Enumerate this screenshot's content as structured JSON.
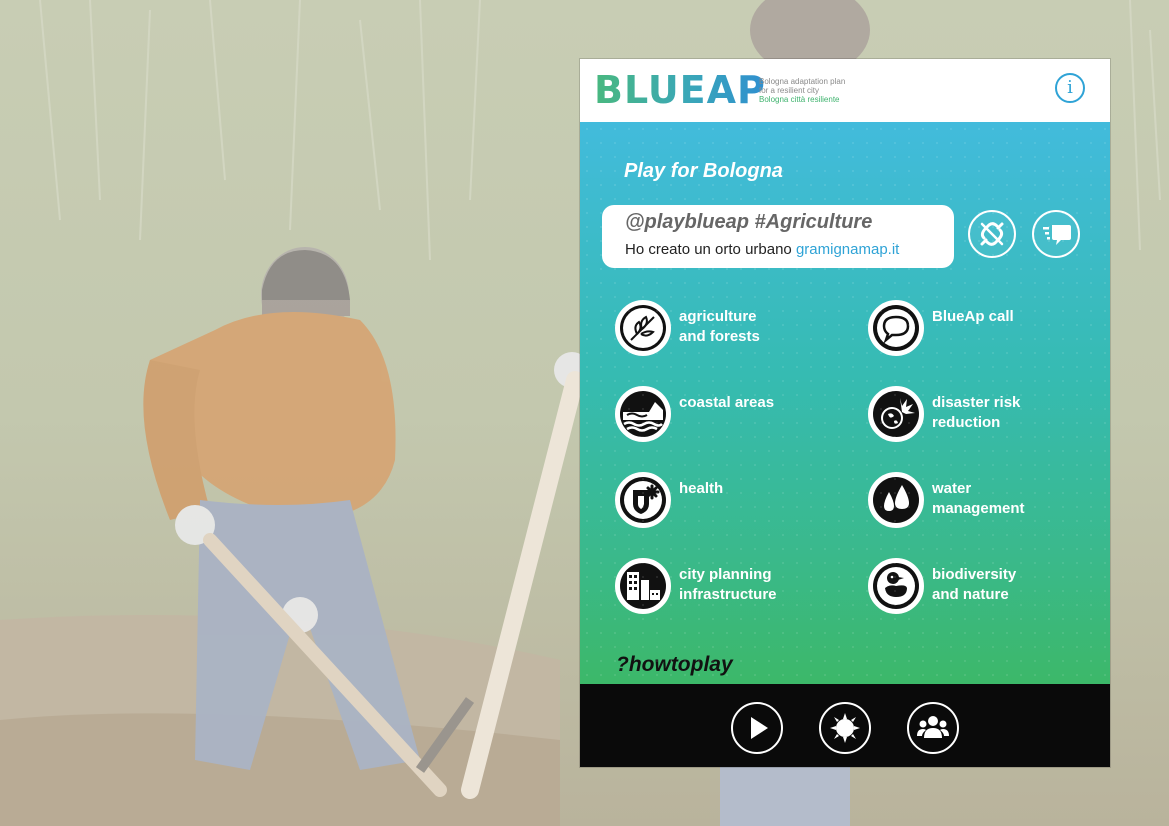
{
  "header": {
    "logo_text": "BLUEAP",
    "logo_sub_line1": "Bologna adaptation plan",
    "logo_sub_line2": "for a resilient city",
    "logo_sub_line3": "Bologna città resiliente",
    "info_label": "i"
  },
  "main": {
    "title": "Play for Bologna",
    "tweet": {
      "tag": "@playblueap #Agriculture",
      "text": "Ho creato un orto urbano ",
      "link": "gramignamap.it"
    },
    "categories": [
      {
        "label_line1": "agriculture",
        "label_line2": "and forests",
        "icon": "leaf-icon"
      },
      {
        "label_line1": "BlueAp call",
        "label_line2": "",
        "icon": "speech-bubble-icon"
      },
      {
        "label_line1": "coastal areas",
        "label_line2": "",
        "icon": "waves-icon"
      },
      {
        "label_line1": "disaster risk",
        "label_line2": "reduction",
        "icon": "explosion-icon"
      },
      {
        "label_line1": "health",
        "label_line2": "",
        "icon": "health-icon"
      },
      {
        "label_line1": "water",
        "label_line2": "management",
        "icon": "water-drops-icon"
      },
      {
        "label_line1": "city planning",
        "label_line2": "infrastructure",
        "icon": "buildings-icon"
      },
      {
        "label_line1": "biodiversity",
        "label_line2": "and nature",
        "icon": "duck-icon"
      }
    ],
    "howto": "?howtoplay"
  },
  "footer": {
    "buttons": [
      "play-icon",
      "sun-icon",
      "group-icon"
    ]
  },
  "colors": {
    "accent_blue": "#2fa3d6",
    "gradient_top": "#42bbdc",
    "gradient_bottom": "#3cb869",
    "footer_bg": "#0a0a0a"
  }
}
